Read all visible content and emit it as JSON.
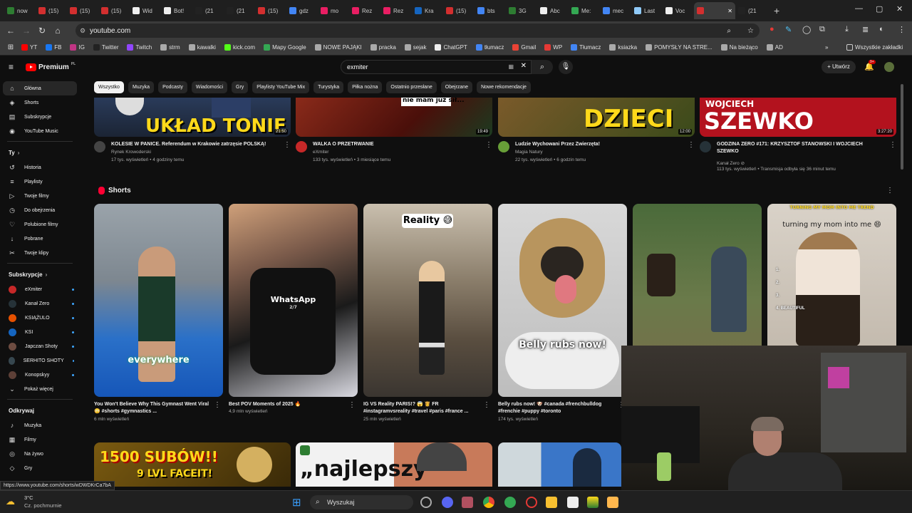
{
  "tabs": [
    {
      "label": "now",
      "color": "#2e7d32"
    },
    {
      "label": "(15)",
      "color": "#d32f2f"
    },
    {
      "label": "(15)",
      "color": "#d32f2f"
    },
    {
      "label": "(15)",
      "color": "#d32f2f"
    },
    {
      "label": "Wid",
      "color": "#eeeeee"
    },
    {
      "label": "Bot!",
      "color": "#eeeeee"
    },
    {
      "label": "(21",
      "color": "#222222"
    },
    {
      "label": "(21",
      "color": "#222222"
    },
    {
      "label": "(15)",
      "color": "#d32f2f"
    },
    {
      "label": "gdz",
      "color": "#4285f4"
    },
    {
      "label": "mo",
      "color": "#e91e63"
    },
    {
      "label": "Rez",
      "color": "#e91e63"
    },
    {
      "label": "Rez",
      "color": "#e91e63"
    },
    {
      "label": "Kra",
      "color": "#1565c0"
    },
    {
      "label": "(15)",
      "color": "#d32f2f"
    },
    {
      "label": "bts",
      "color": "#4285f4"
    },
    {
      "label": "3G",
      "color": "#2e7d32"
    },
    {
      "label": "Abc",
      "color": "#eeeeee"
    },
    {
      "label": "Me:",
      "color": "#34a853"
    },
    {
      "label": "mec",
      "color": "#4285f4"
    },
    {
      "label": "Last",
      "color": "#90caf9"
    },
    {
      "label": "Voc",
      "color": "#eeeeee"
    },
    {
      "label": "",
      "color": "#d32f2f"
    },
    {
      "label": "(21",
      "color": "#222222"
    }
  ],
  "address": {
    "url": "youtube.com"
  },
  "bookmarks": [
    {
      "label": "YT",
      "color": "#ff0000"
    },
    {
      "label": "FB",
      "color": "#1877f2"
    },
    {
      "label": "IG",
      "color": "#c13584"
    },
    {
      "label": "Twitter",
      "color": "#222222"
    },
    {
      "label": "Twitch",
      "color": "#9146ff"
    },
    {
      "label": "strm",
      "color": "#aaaaaa"
    },
    {
      "label": "kawalki",
      "color": "#aaaaaa"
    },
    {
      "label": "kick.com",
      "color": "#53fc18"
    },
    {
      "label": "Mapy Google",
      "color": "#34a853"
    },
    {
      "label": "NOWE PAJĄKI",
      "color": "#aaaaaa"
    },
    {
      "label": "pracka",
      "color": "#aaaaaa"
    },
    {
      "label": "sejak",
      "color": "#aaaaaa"
    },
    {
      "label": "ChatGPT",
      "color": "#eeeeee"
    },
    {
      "label": "tłumacz",
      "color": "#4285f4"
    },
    {
      "label": "Gmail",
      "color": "#ea4335"
    },
    {
      "label": "WP",
      "color": "#e53935"
    },
    {
      "label": "Tłumacz",
      "color": "#4285f4"
    },
    {
      "label": "ksiazka",
      "color": "#aaaaaa"
    },
    {
      "label": "POMYSŁY NA STRE...",
      "color": "#aaaaaa"
    },
    {
      "label": "Na bieżąco",
      "color": "#aaaaaa"
    },
    {
      "label": "AD",
      "color": "#aaaaaa"
    }
  ],
  "bookmarks_right": "Wszystkie zakładki",
  "yt": {
    "logo": "Premium",
    "logo_region": "PL",
    "search_value": "exmiter",
    "create": "Utwórz",
    "notif_count": "9+"
  },
  "chips": [
    "Wszystko",
    "Muzyka",
    "Podcasty",
    "Wiadomości",
    "Gry",
    "Playlisty YouTube Mix",
    "Turystyka",
    "Piłka nożna",
    "Ostatnio przesłane",
    "Obejrzane",
    "Nowe rekomendacje"
  ],
  "sidebar": {
    "main": [
      {
        "label": "Główna",
        "icon": "⌂"
      },
      {
        "label": "Shorts",
        "icon": "◈"
      },
      {
        "label": "Subskrypcje",
        "icon": "▤"
      },
      {
        "label": "YouTube Music",
        "icon": "◉"
      }
    ],
    "you_header": "Ty",
    "you": [
      {
        "label": "Historia",
        "icon": "↺"
      },
      {
        "label": "Playlisty",
        "icon": "≡"
      },
      {
        "label": "Twoje filmy",
        "icon": "▷"
      },
      {
        "label": "Do obejrzenia",
        "icon": "◷"
      },
      {
        "label": "Polubione filmy",
        "icon": "♡"
      },
      {
        "label": "Pobrane",
        "icon": "↓"
      },
      {
        "label": "Twoje klipy",
        "icon": "✂"
      }
    ],
    "subs_header": "Subskrypcje",
    "subs": [
      {
        "label": "eXmiter",
        "color": "#c62828"
      },
      {
        "label": "Kanał Zero",
        "color": "#263238"
      },
      {
        "label": "KSIĄŻULO",
        "color": "#e65100"
      },
      {
        "label": "KSI",
        "color": "#1565c0"
      },
      {
        "label": "Japczan Shoty",
        "color": "#6d4c41"
      },
      {
        "label": "SERHITO SHOTY",
        "color": "#37474f"
      },
      {
        "label": "Konopskyy",
        "color": "#5d4037"
      }
    ],
    "more": "Pokaż więcej",
    "explore_header": "Odkrywaj",
    "explore": [
      {
        "label": "Muzyka",
        "icon": "♪"
      },
      {
        "label": "Filmy",
        "icon": "▦"
      },
      {
        "label": "Na żywo",
        "icon": "◎"
      },
      {
        "label": "Gry",
        "icon": "◇"
      }
    ]
  },
  "videos": [
    {
      "title": "KOLESIE W PANICE. Referendum w Krakowie zatrzęsie POLSKĄ!",
      "channel": "Rynek Krowoderski",
      "stats": "17 tys. wyświetleń • 4 godziny temu",
      "duration": "21:50",
      "overlay": "UKŁAD TONIE",
      "avatar": "#444444"
    },
    {
      "title": "WALKA O PRZETRWANIE",
      "channel": "eXmiter",
      "stats": "133 tys. wyświetleń • 3 miesiące temu",
      "duration": "19:49",
      "overlay": "nie mam już sił...",
      "avatar": "#c62828"
    },
    {
      "title": "Ludzie Wychowani Przez Zwierzęta!",
      "channel": "Magia Natury",
      "stats": "22 tys. wyświetleń • 6 godzin temu",
      "duration": "12:00",
      "overlay": "DZIECI",
      "avatar": "#689f38"
    },
    {
      "title": "GODZINA ZERO #171: KRZYSZTOF STANOWSKI I WOJCIECH SZEWKO",
      "channel": "Kanał Zero ⊘",
      "stats": "113 tys. wyświetleń • Transmisja odbyła się 36 minut temu",
      "duration": "3:27:20",
      "overlay": "SZEWKO",
      "overlay2": "WOJCIECH",
      "avatar": "#263238"
    }
  ],
  "shorts_header": "Shorts",
  "shorts": [
    {
      "title": "You Won't Believe Why This Gymnast Went Viral 😳 #shorts #gymnastics ...",
      "views": "6 mln wyświetleń",
      "caption": "everywhere"
    },
    {
      "title": "Best POV Moments of 2025 🔥",
      "views": "4,9 mln wyświetleń",
      "caption": "WhatsApp",
      "caption2": "2/7"
    },
    {
      "title": "IG VS Reality PARIS!? 😱 👸 FR #instagramvsreality #travel #paris #france ...",
      "views": "25 mln wyświetleń",
      "caption": "Reality 😅"
    },
    {
      "title": "Belly rubs now! 🐶 #canada #frenchbulldog #frenchie #puppy #toronto",
      "views": "174 tys. wyświetleń",
      "caption": "Belly rubs now!"
    },
    {
      "title": "",
      "views": "",
      "caption": ""
    },
    {
      "title": "",
      "views": "",
      "caption": "turning my mom into me 😄",
      "caption_top": "TURNING MY MOM INTO ME TREND",
      "list": "1.\n2.\n3.\n4. BEAUTIFUL"
    }
  ],
  "bottom": [
    {
      "overlay": "1500 SUBÓW!!",
      "overlay2": "9 LVL FACEIT!"
    },
    {
      "overlay": "„najlepszy”"
    },
    {
      "overlay": ""
    }
  ],
  "status_url": "https://www.youtube.com/shorts/wDWDKrCa7bA",
  "weather": {
    "temp": "3°C",
    "desc": "Cz. pochmurnie"
  },
  "taskbar_search": "Wyszukaj"
}
